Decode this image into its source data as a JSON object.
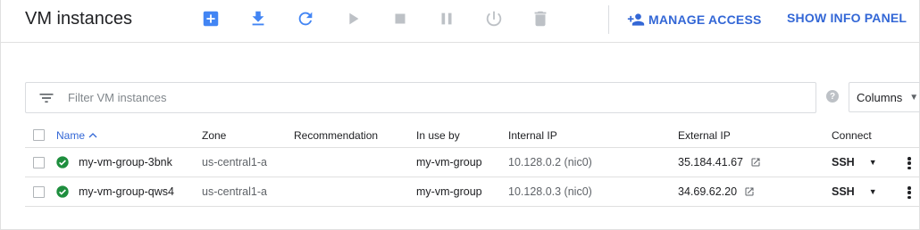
{
  "header": {
    "title": "VM instances",
    "toolbar": [
      {
        "name": "create-instance-button",
        "icon": "add-box-icon",
        "enabled": true
      },
      {
        "name": "import-vm-button",
        "icon": "download-icon",
        "enabled": true
      },
      {
        "name": "refresh-button",
        "icon": "refresh-icon",
        "enabled": true
      },
      {
        "name": "start-button",
        "icon": "play-icon",
        "enabled": false
      },
      {
        "name": "stop-button",
        "icon": "stop-icon",
        "enabled": false
      },
      {
        "name": "suspend-button",
        "icon": "pause-icon",
        "enabled": false
      },
      {
        "name": "reset-button",
        "icon": "power-icon",
        "enabled": false
      },
      {
        "name": "delete-button",
        "icon": "trash-icon",
        "enabled": false
      }
    ],
    "manage_access_label": "MANAGE ACCESS",
    "show_info_panel_label": "SHOW INFO PANEL"
  },
  "filter": {
    "placeholder": "Filter VM instances",
    "columns_label": "Columns"
  },
  "table": {
    "columns": {
      "name": "Name",
      "zone": "Zone",
      "recommendation": "Recommendation",
      "in_use_by": "In use by",
      "internal_ip": "Internal IP",
      "external_ip": "External IP",
      "connect": "Connect"
    },
    "rows": [
      {
        "name": "my-vm-group-3bnk",
        "zone": "us-central1-a",
        "recommendation": "",
        "in_use_by": "my-vm-group",
        "internal_ip": "10.128.0.2 (nic0)",
        "external_ip": "35.184.41.67",
        "connect": "SSH",
        "status": "running"
      },
      {
        "name": "my-vm-group-qws4",
        "zone": "us-central1-a",
        "recommendation": "",
        "in_use_by": "my-vm-group",
        "internal_ip": "10.128.0.3 (nic0)",
        "external_ip": "34.69.62.20",
        "connect": "SSH",
        "status": "running"
      }
    ]
  },
  "colors": {
    "accent": "#3367d6",
    "toolbar_active": "#4285f4",
    "toolbar_disabled": "#bdc1c6",
    "status_ok": "#1e8e3e"
  }
}
